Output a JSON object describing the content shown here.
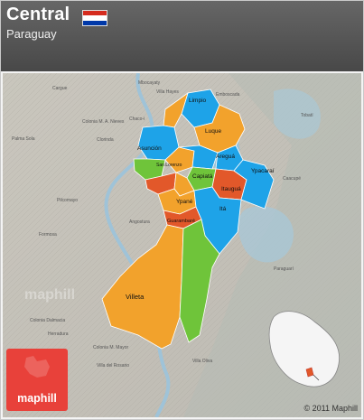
{
  "header": {
    "title": "Central",
    "subtitle": "Paraguay",
    "flag_colors": [
      "#d52b1e",
      "#ffffff",
      "#0038a8"
    ]
  },
  "map": {
    "colors": {
      "land_relief": "#c8c5bb",
      "water": "#9fc3d8",
      "blue_region": "#1ea3e8",
      "orange_region": "#f2a22c",
      "red_region": "#e2582a",
      "green_region": "#6fc43a",
      "border": "#ffffff"
    },
    "district_labels": [
      {
        "id": "limpio",
        "text": "Limpio"
      },
      {
        "id": "luque",
        "text": "Luque"
      },
      {
        "id": "asuncion",
        "text": "Asunción"
      },
      {
        "id": "aregua",
        "text": "Areguá"
      },
      {
        "id": "capiata",
        "text": "Capiatá"
      },
      {
        "id": "ypacarai",
        "text": "Ypacaraí"
      },
      {
        "id": "itaugua",
        "text": "Itauguá"
      },
      {
        "id": "ypane",
        "text": "Ypané"
      },
      {
        "id": "guarambare",
        "text": "Guarambaré"
      },
      {
        "id": "ita",
        "text": "Itá"
      },
      {
        "id": "villeta",
        "text": "Villeta"
      },
      {
        "id": "san-lorenzo",
        "text": "San Lorenzo"
      }
    ],
    "background_labels": [
      {
        "id": "mbocayaty",
        "text": "Mbocayaty"
      },
      {
        "id": "cargue",
        "text": "Cargue"
      },
      {
        "id": "villa-hayes",
        "text": "Villa Hayes"
      },
      {
        "id": "emboscada",
        "text": "Emboscada"
      },
      {
        "id": "chaco-i",
        "text": "Chaco-i"
      },
      {
        "id": "palma-sola",
        "text": "Palma Sola"
      },
      {
        "id": "colonia-m-a-nieves",
        "text": "Colonia M. A. Nieves"
      },
      {
        "id": "clorinda",
        "text": "Clorinda"
      },
      {
        "id": "formosa",
        "text": "Formosa"
      },
      {
        "id": "pilcomayo",
        "text": "Pilcomayo"
      },
      {
        "id": "angostura",
        "text": "Angostura"
      },
      {
        "id": "caacupe",
        "text": "Caacupé"
      },
      {
        "id": "tobati",
        "text": "Tobatí"
      },
      {
        "id": "paraguari",
        "text": "Paraguarí"
      },
      {
        "id": "colonia-dalmacia",
        "text": "Colonia Dalmacia"
      },
      {
        "id": "villeta-ar",
        "text": "Villa del Rosario"
      },
      {
        "id": "colonia-mayor",
        "text": "Colonia M. Mayor"
      },
      {
        "id": "herradura",
        "text": "Herradura"
      },
      {
        "id": "villalibre",
        "text": "Villa Oliva"
      }
    ],
    "watermark": "maphill"
  },
  "logo": {
    "text": "maphill"
  },
  "copyright": "© 2011 Maphill"
}
